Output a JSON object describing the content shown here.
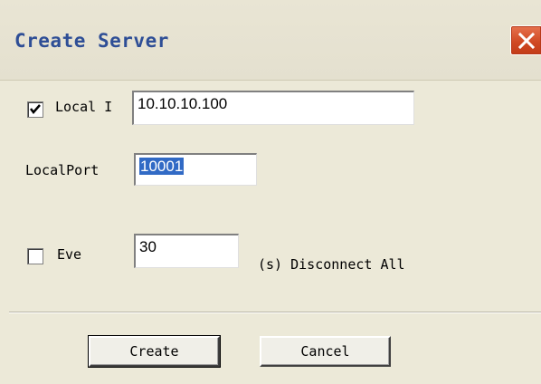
{
  "dialog": {
    "title": "Create Server",
    "close_icon": "close-x-icon",
    "accent_color": "#2e4e96",
    "close_color": "#d14a24"
  },
  "local_ip": {
    "checked": true,
    "label": "Local I",
    "value": "10.10.10.100"
  },
  "local_port": {
    "label": "LocalPort",
    "value": "10001"
  },
  "every": {
    "checked": false,
    "label": "Eve",
    "value": "30",
    "suffix": "(s) Disconnect All"
  },
  "buttons": {
    "create": "Create",
    "cancel": "Cancel"
  }
}
